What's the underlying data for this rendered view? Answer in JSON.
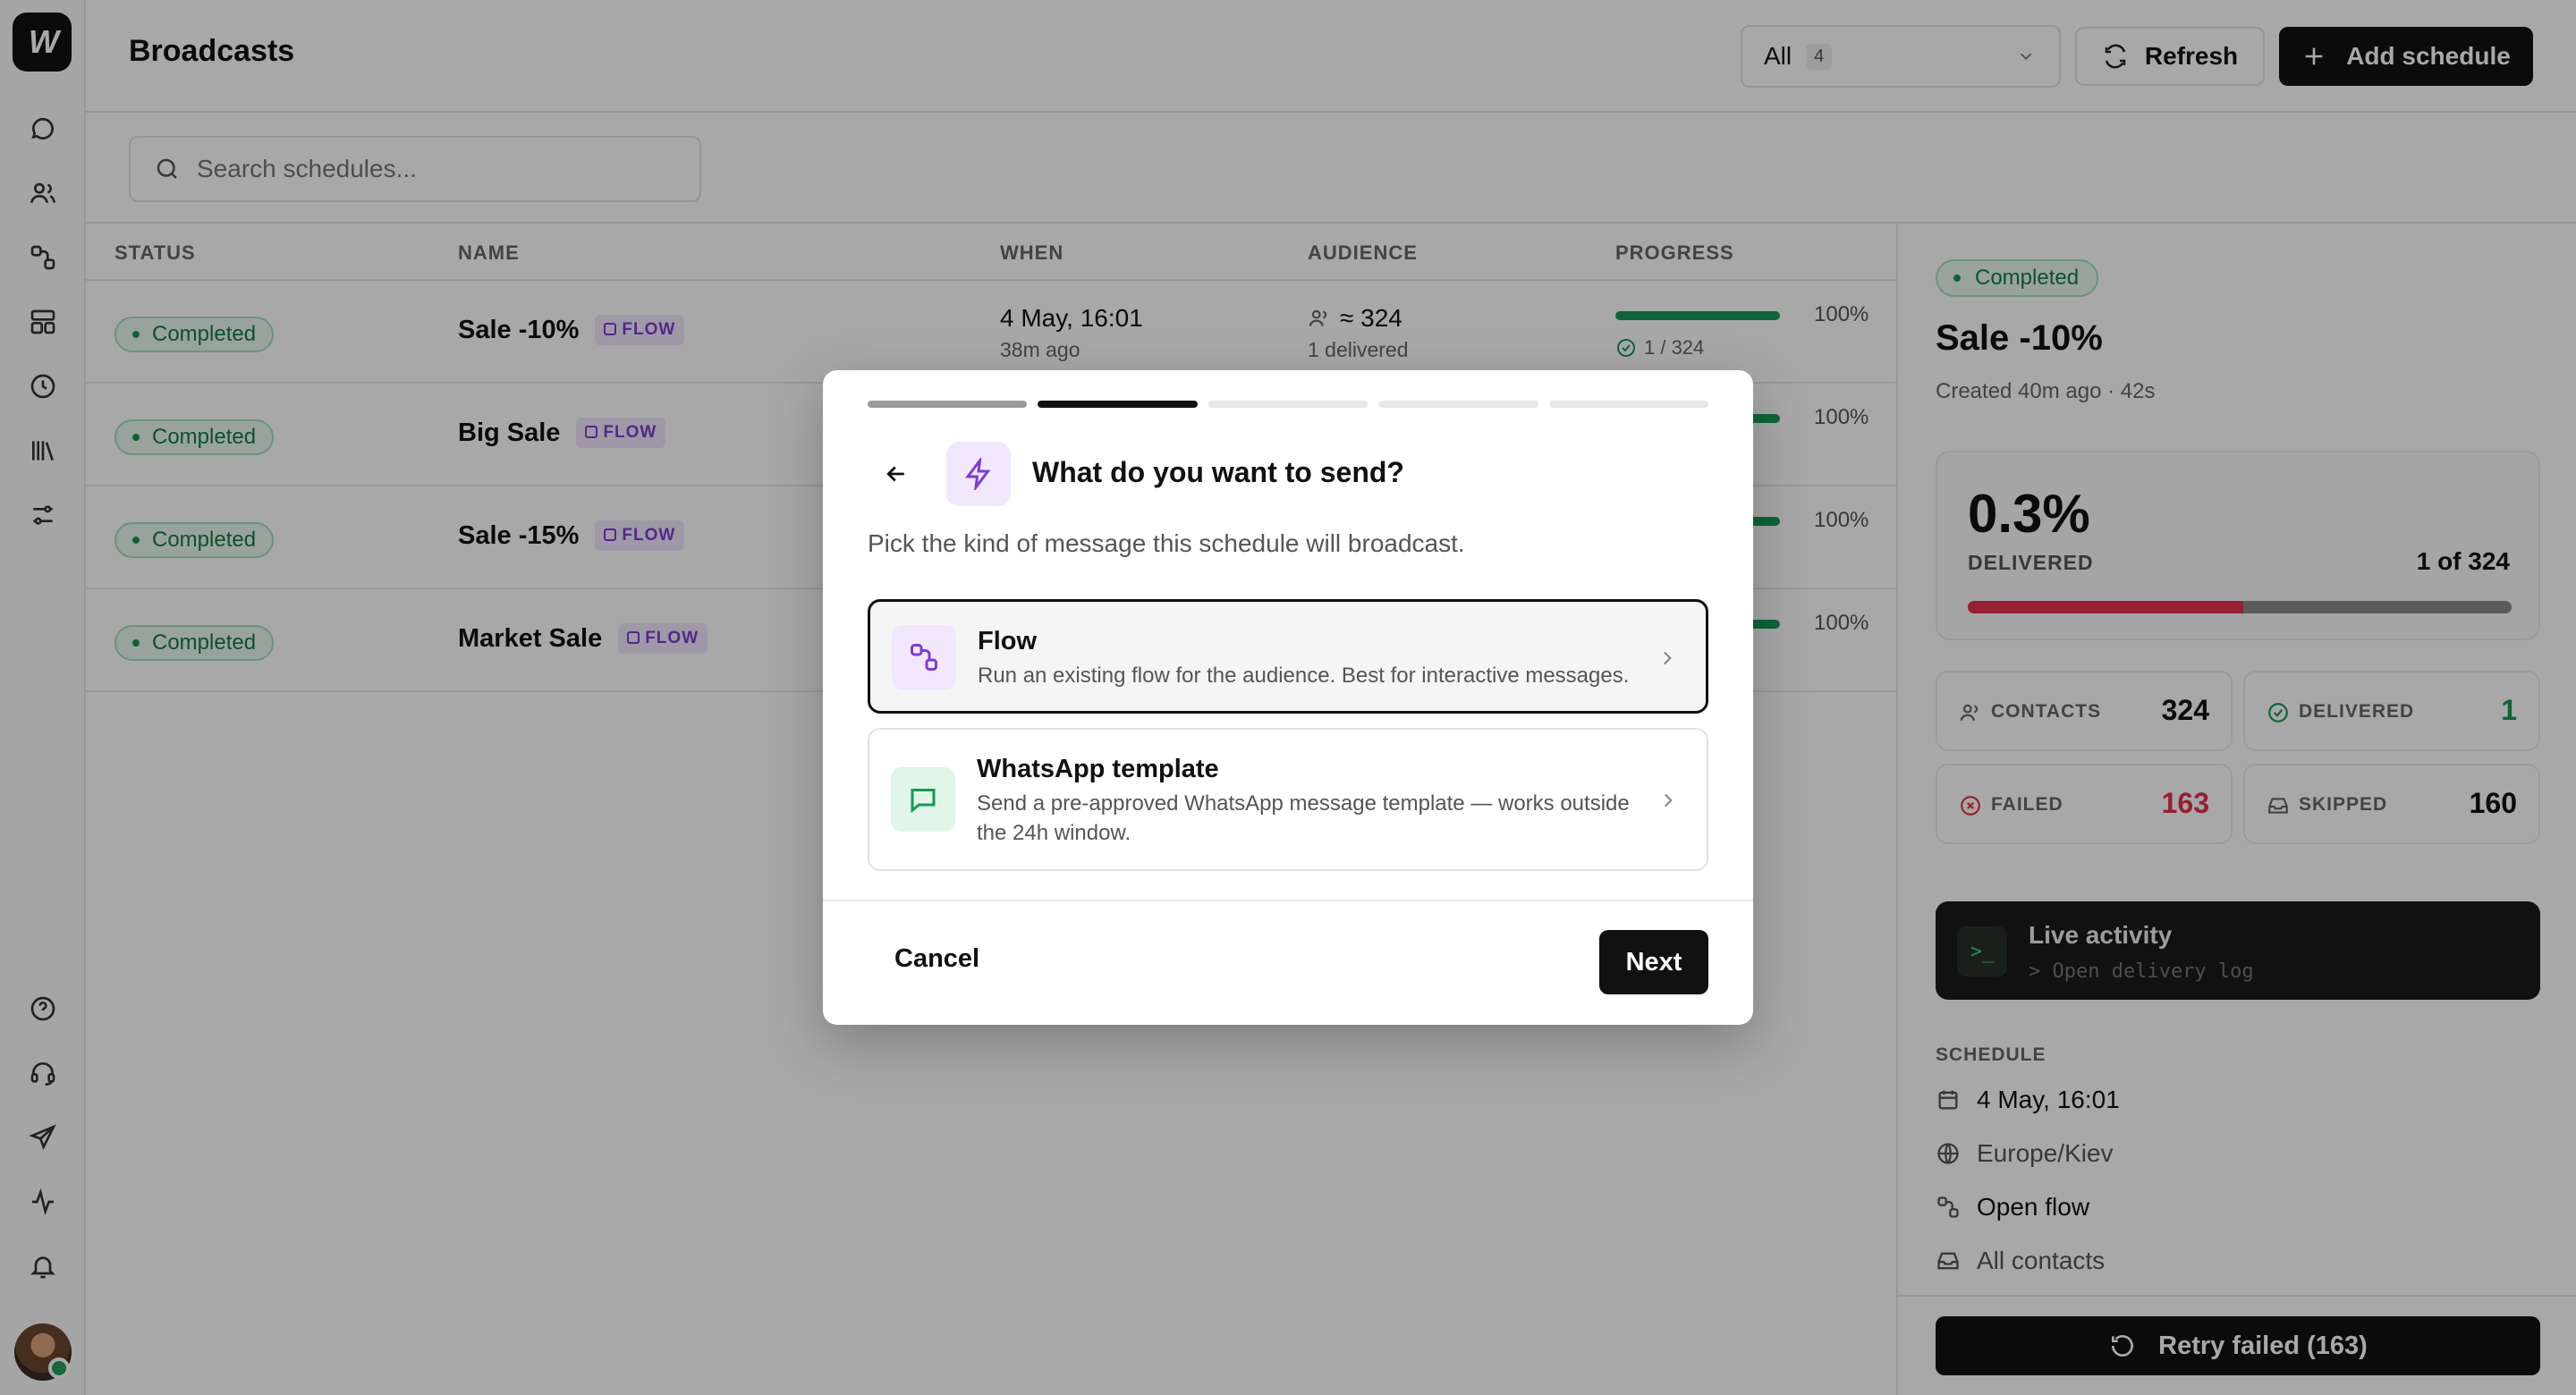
{
  "app": {
    "logo_text": "W"
  },
  "header": {
    "title": "Broadcasts",
    "filter": {
      "value": "All",
      "count": "4"
    },
    "refresh_label": "Refresh",
    "add_label": "Add schedule"
  },
  "search": {
    "placeholder": "Search schedules..."
  },
  "table": {
    "columns": [
      "STATUS",
      "NAME",
      "WHEN",
      "AUDIENCE",
      "PROGRESS"
    ],
    "rows": [
      {
        "status": "Completed",
        "name": "Sale -10%",
        "tag": "FLOW",
        "when": "4 May, 16:01",
        "when_sub": "38m ago",
        "audience": "≈ 324",
        "audience_sub": "1 delivered",
        "progress": 1.0,
        "progress_label": "100%",
        "progress_sub": "1 / 324"
      },
      {
        "status": "Completed",
        "name": "Big Sale",
        "tag": "FLOW",
        "progress": 1.0,
        "progress_label": "100%"
      },
      {
        "status": "Completed",
        "name": "Sale -15%",
        "tag": "FLOW",
        "progress": 1.0,
        "progress_label": "100%"
      },
      {
        "status": "Completed",
        "name": "Market Sale",
        "tag": "FLOW",
        "progress": 1.0,
        "progress_label": "100%"
      }
    ]
  },
  "panel": {
    "status": "Completed",
    "title": "Sale -10%",
    "created": "Created 40m ago · 42s",
    "delivered_pct": "0.3%",
    "delivered_label": "DELIVERED",
    "delivered_of": "1 of 324",
    "delivered_fraction": 0.507,
    "stats": {
      "contacts": {
        "label": "CONTACTS",
        "value": "324"
      },
      "delivered": {
        "label": "DELIVERED",
        "value": "1"
      },
      "failed": {
        "label": "FAILED",
        "value": "163"
      },
      "skipped": {
        "label": "SKIPPED",
        "value": "160"
      }
    },
    "live": {
      "title": "Live activity",
      "subtitle": "> Open delivery log",
      "term_glyph": ">_"
    },
    "schedule_label": "SCHEDULE",
    "schedule": {
      "date": "4 May, 16:01",
      "timezone": "Europe/Kiev",
      "flow": "Open flow",
      "audience": "All contacts"
    },
    "retry_label": "Retry failed (163)"
  },
  "modal": {
    "steps_total": 5,
    "step_current": 2,
    "title": "What do you want to send?",
    "subtitle": "Pick the kind of message this schedule will broadcast.",
    "options": [
      {
        "title": "Flow",
        "description": "Run an existing flow for the audience. Best for interactive messages.",
        "selected": true
      },
      {
        "title": "WhatsApp template",
        "description": "Send a pre-approved WhatsApp message template — works outside the 24h window.",
        "selected": false
      }
    ],
    "cancel_label": "Cancel",
    "next_label": "Next"
  },
  "colors": {
    "accent": "#111111",
    "success": "#169955",
    "danger": "#e2314d",
    "flow_purple": "#7e3cd3"
  }
}
